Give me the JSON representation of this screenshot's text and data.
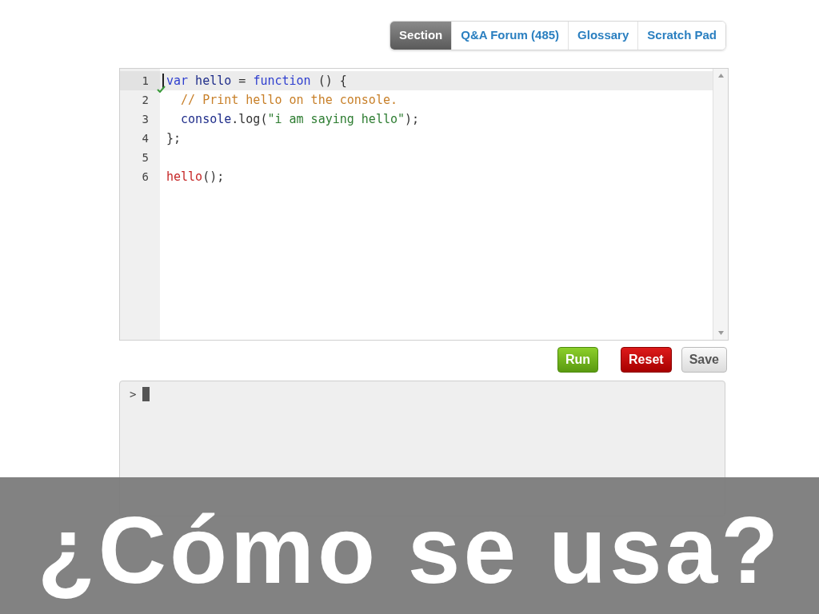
{
  "tabs": [
    {
      "label": "Section",
      "selected": true
    },
    {
      "label": "Q&A Forum (485)",
      "selected": false
    },
    {
      "label": "Glossary",
      "selected": false
    },
    {
      "label": "Scratch Pad",
      "selected": false
    }
  ],
  "editor": {
    "lines": [
      {
        "number": "1",
        "active": true,
        "tokens": [
          {
            "kind": "keyword",
            "text": "var"
          },
          {
            "kind": "variable",
            "text": " hello "
          },
          {
            "kind": "punct",
            "text": "= "
          },
          {
            "kind": "keyword",
            "text": "function"
          },
          {
            "kind": "punct",
            "text": " () {"
          }
        ]
      },
      {
        "number": "2",
        "active": false,
        "tokens": [
          {
            "kind": "comment",
            "text": "  // Print hello on the console."
          }
        ]
      },
      {
        "number": "3",
        "active": false,
        "tokens": [
          {
            "kind": "variable",
            "text": "  console"
          },
          {
            "kind": "punct",
            "text": ".log("
          },
          {
            "kind": "string",
            "text": "\"i am saying hello\""
          },
          {
            "kind": "punct",
            "text": ");"
          }
        ]
      },
      {
        "number": "4",
        "active": false,
        "tokens": [
          {
            "kind": "punct",
            "text": "};"
          }
        ]
      },
      {
        "number": "5",
        "active": false
      },
      {
        "number": "6",
        "active": false,
        "tokens": [
          {
            "kind": "call",
            "text": "hello"
          },
          {
            "kind": "punct",
            "text": "();"
          }
        ]
      }
    ]
  },
  "buttons": [
    {
      "label": "Run",
      "kind": "run"
    },
    {
      "label": "Reset",
      "kind": "reset"
    },
    {
      "label": "Save",
      "kind": "save"
    }
  ],
  "console": {
    "prompt": ">"
  },
  "banner": {
    "title": "¿Cómo se usa?"
  }
}
